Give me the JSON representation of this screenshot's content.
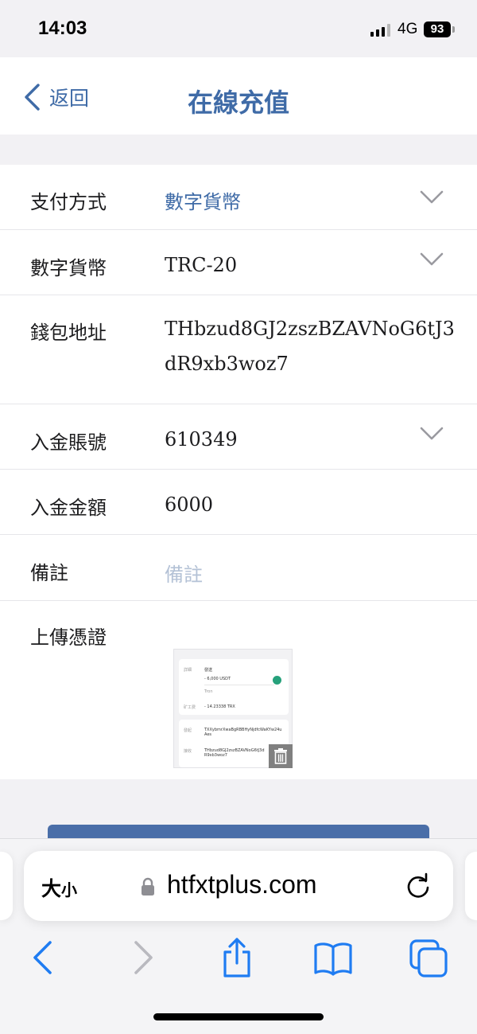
{
  "status_bar": {
    "time": "14:03",
    "network": "4G",
    "battery": "93"
  },
  "nav": {
    "back_label": "返回",
    "title": "在線充值"
  },
  "form": {
    "payment_method": {
      "label": "支付方式",
      "value": "數字貨幣"
    },
    "currency": {
      "label": "數字貨幣",
      "value": "TRC-20"
    },
    "wallet": {
      "label": "錢包地址",
      "value": "THbzud8GJ2zszBZAVNoG6tJ3dR9xb3woz7"
    },
    "account": {
      "label": "入金賬號",
      "value": "610349"
    },
    "amount": {
      "label": "入金金額",
      "value": "6000"
    },
    "remark": {
      "label": "備註",
      "placeholder": "備註"
    },
    "upload": {
      "label": "上傳憑證"
    }
  },
  "voucher_thumbnail": {
    "label_1": "詳細",
    "type": "發送",
    "amount": "- 6,000 USDT",
    "subtitle": "Tron",
    "fee_label": "矿工费",
    "fee": "- 14.23338 TRX",
    "from_label": "發起",
    "from_addr": "TXXybmrXwaBgRBBHyNjdfcWaKYw24uAes",
    "to_label": "接收",
    "to_addr": "THbzud8GJ2zszBZAVNoG6tJ3dR9xb3woz7"
  },
  "browser": {
    "text_size": {
      "big": "大",
      "small": "小"
    },
    "url": "htfxtplus.com"
  },
  "colors": {
    "accent": "#3f6ba7",
    "button": "#4a6ea8",
    "placeholder": "#b4c2d6",
    "ios_blue": "#1f7cf2"
  }
}
